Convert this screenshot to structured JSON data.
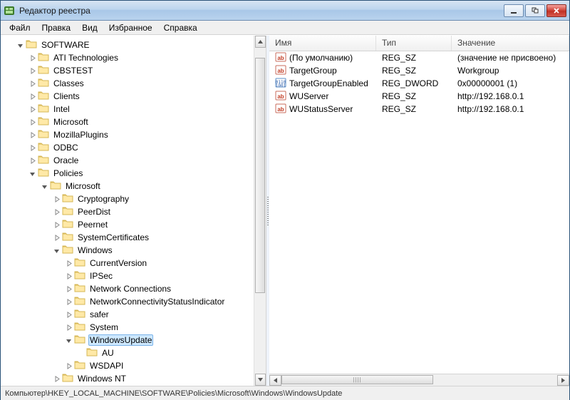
{
  "window": {
    "title": "Редактор реестра"
  },
  "menu": {
    "file": "Файл",
    "edit": "Правка",
    "view": "Вид",
    "favorites": "Избранное",
    "help": "Справка"
  },
  "tree": [
    {
      "indent": 1,
      "expand": "open",
      "label": "SOFTWARE"
    },
    {
      "indent": 2,
      "expand": "closed",
      "label": "ATI Technologies"
    },
    {
      "indent": 2,
      "expand": "closed",
      "label": "CBSTEST"
    },
    {
      "indent": 2,
      "expand": "closed",
      "label": "Classes"
    },
    {
      "indent": 2,
      "expand": "closed",
      "label": "Clients"
    },
    {
      "indent": 2,
      "expand": "closed",
      "label": "Intel"
    },
    {
      "indent": 2,
      "expand": "closed",
      "label": "Microsoft"
    },
    {
      "indent": 2,
      "expand": "closed",
      "label": "MozillaPlugins"
    },
    {
      "indent": 2,
      "expand": "closed",
      "label": "ODBC"
    },
    {
      "indent": 2,
      "expand": "closed",
      "label": "Oracle"
    },
    {
      "indent": 2,
      "expand": "open",
      "label": "Policies"
    },
    {
      "indent": 3,
      "expand": "open",
      "label": "Microsoft"
    },
    {
      "indent": 4,
      "expand": "closed",
      "label": "Cryptography"
    },
    {
      "indent": 4,
      "expand": "closed",
      "label": "PeerDist"
    },
    {
      "indent": 4,
      "expand": "closed",
      "label": "Peernet"
    },
    {
      "indent": 4,
      "expand": "closed",
      "label": "SystemCertificates"
    },
    {
      "indent": 4,
      "expand": "open",
      "label": "Windows"
    },
    {
      "indent": 5,
      "expand": "closed",
      "label": "CurrentVersion"
    },
    {
      "indent": 5,
      "expand": "closed",
      "label": "IPSec"
    },
    {
      "indent": 5,
      "expand": "closed",
      "label": "Network Connections"
    },
    {
      "indent": 5,
      "expand": "closed",
      "label": "NetworkConnectivityStatusIndicator"
    },
    {
      "indent": 5,
      "expand": "closed",
      "label": "safer"
    },
    {
      "indent": 5,
      "expand": "closed",
      "label": "System"
    },
    {
      "indent": 5,
      "expand": "open",
      "label": "WindowsUpdate",
      "selected": true
    },
    {
      "indent": 6,
      "expand": "none",
      "label": "AU"
    },
    {
      "indent": 5,
      "expand": "closed",
      "label": "WSDAPI"
    },
    {
      "indent": 4,
      "expand": "closed",
      "label": "Windows NT"
    }
  ],
  "columns": {
    "name": "Имя",
    "type": "Тип",
    "value": "Значение"
  },
  "values": [
    {
      "icon": "string",
      "name": "(По умолчанию)",
      "type": "REG_SZ",
      "value": "(значение не присвоено)"
    },
    {
      "icon": "string",
      "name": "TargetGroup",
      "type": "REG_SZ",
      "value": "Workgroup"
    },
    {
      "icon": "binary",
      "name": "TargetGroupEnabled",
      "type": "REG_DWORD",
      "value": "0x00000001 (1)"
    },
    {
      "icon": "string",
      "name": "WUServer",
      "type": "REG_SZ",
      "value": "http://192.168.0.1"
    },
    {
      "icon": "string",
      "name": "WUStatusServer",
      "type": "REG_SZ",
      "value": "http://192.168.0.1"
    }
  ],
  "statusbar": "Компьютер\\HKEY_LOCAL_MACHINE\\SOFTWARE\\Policies\\Microsoft\\Windows\\WindowsUpdate"
}
